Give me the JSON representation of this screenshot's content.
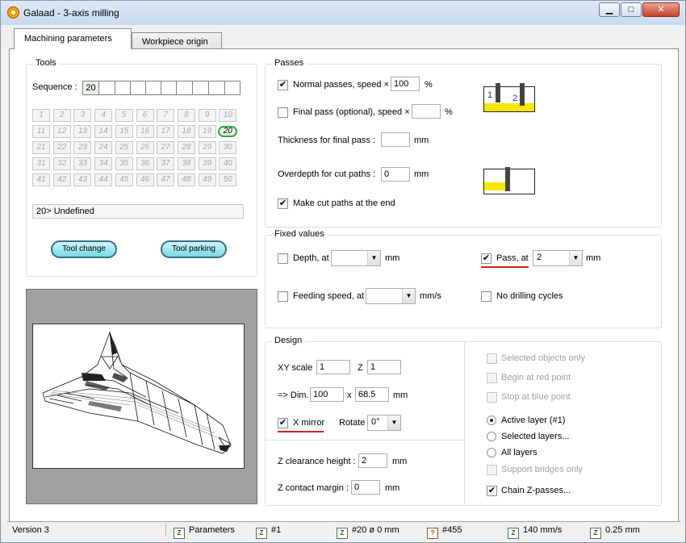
{
  "window": {
    "title": "Galaad  -  3-axis milling",
    "controls": {
      "minimize": "▁",
      "maximize": "□",
      "close": "✕"
    }
  },
  "tabs": [
    {
      "label": "Machining parameters"
    },
    {
      "label": "Workpiece origin"
    }
  ],
  "tools": {
    "title": "Tools",
    "sequence_label": "Sequence :",
    "sequence": [
      "20",
      "",
      "",
      "",
      "",
      "",
      "",
      "",
      "",
      ""
    ],
    "grid": [
      [
        "1",
        "2",
        "3",
        "4",
        "5",
        "6",
        "7",
        "8",
        "9",
        "10"
      ],
      [
        "11",
        "12",
        "13",
        "14",
        "15",
        "16",
        "17",
        "18",
        "19",
        "20"
      ],
      [
        "21",
        "22",
        "23",
        "24",
        "25",
        "26",
        "27",
        "28",
        "29",
        "30"
      ],
      [
        "31",
        "32",
        "33",
        "34",
        "35",
        "36",
        "37",
        "38",
        "39",
        "40"
      ],
      [
        "41",
        "42",
        "43",
        "44",
        "45",
        "46",
        "47",
        "48",
        "49",
        "50"
      ]
    ],
    "selected_tool": "20",
    "tool_description": "20>  Undefined",
    "tool_change_label": "Tool change",
    "tool_parking_label": "Tool parking"
  },
  "passes": {
    "title": "Passes",
    "normal_label": "Normal passes, speed ×",
    "normal_value": "100",
    "normal_unit": "%",
    "normal_checked": true,
    "final_label": "Final pass (optional), speed ×",
    "final_value": "",
    "final_unit": "%",
    "final_checked": false,
    "thickness_label": "Thickness for final pass :",
    "thickness_value": "",
    "thickness_unit": "mm",
    "overdepth_label": "Overdepth for cut paths :",
    "overdepth_value": "0",
    "overdepth_unit": "mm",
    "cutpaths_label": "Make cut paths at the end",
    "cutpaths_checked": true,
    "diagram_labels": [
      "1",
      "2"
    ]
  },
  "fixed": {
    "title": "Fixed values",
    "depth_label": "Depth, at",
    "depth_value": "",
    "depth_unit": "mm",
    "depth_checked": false,
    "pass_label": "Pass, at",
    "pass_value": "2",
    "pass_unit": "mm",
    "pass_checked": true,
    "feed_label": "Feeding speed, at",
    "feed_value": "",
    "feed_unit": "mm/s",
    "feed_checked": false,
    "nodrill_label": "No drilling cycles",
    "nodrill_checked": false
  },
  "design": {
    "title": "Design",
    "xy_label": "XY scale",
    "xy_value": "1",
    "z_label": "Z",
    "z_value": "1",
    "dim_label": "=> Dim.",
    "dim_x": "100",
    "dim_sep": "x",
    "dim_y": "68.5",
    "dim_unit": "mm",
    "mirror_label": "X mirror",
    "mirror_checked": true,
    "rotate_label": "Rotate",
    "rotate_value": "0°",
    "zclear_label": "Z clearance height :",
    "zclear_value": "2",
    "zclear_unit": "mm",
    "zcontact_label": "Z contact margin :",
    "zcontact_value": "0",
    "zcontact_unit": "mm",
    "options": {
      "selected_only": "Selected objects only",
      "begin_red": "Begin at red point",
      "stop_blue": "Stop at blue point",
      "active_layer": "Active layer (#1)",
      "selected_layers": "Selected layers...",
      "all_layers": "All layers",
      "support_bridges": "Support bridges only",
      "chain_z": "Chain Z-passes..."
    },
    "chain_checked": true
  },
  "statusbar": {
    "version": "Version 3",
    "parameters": "Parameters",
    "layer": "#1",
    "tool": "#20  ø 0 mm",
    "objects": "#455",
    "speed": "140 mm/s",
    "pass": "0.25 mm"
  },
  "check_mark": "✔"
}
